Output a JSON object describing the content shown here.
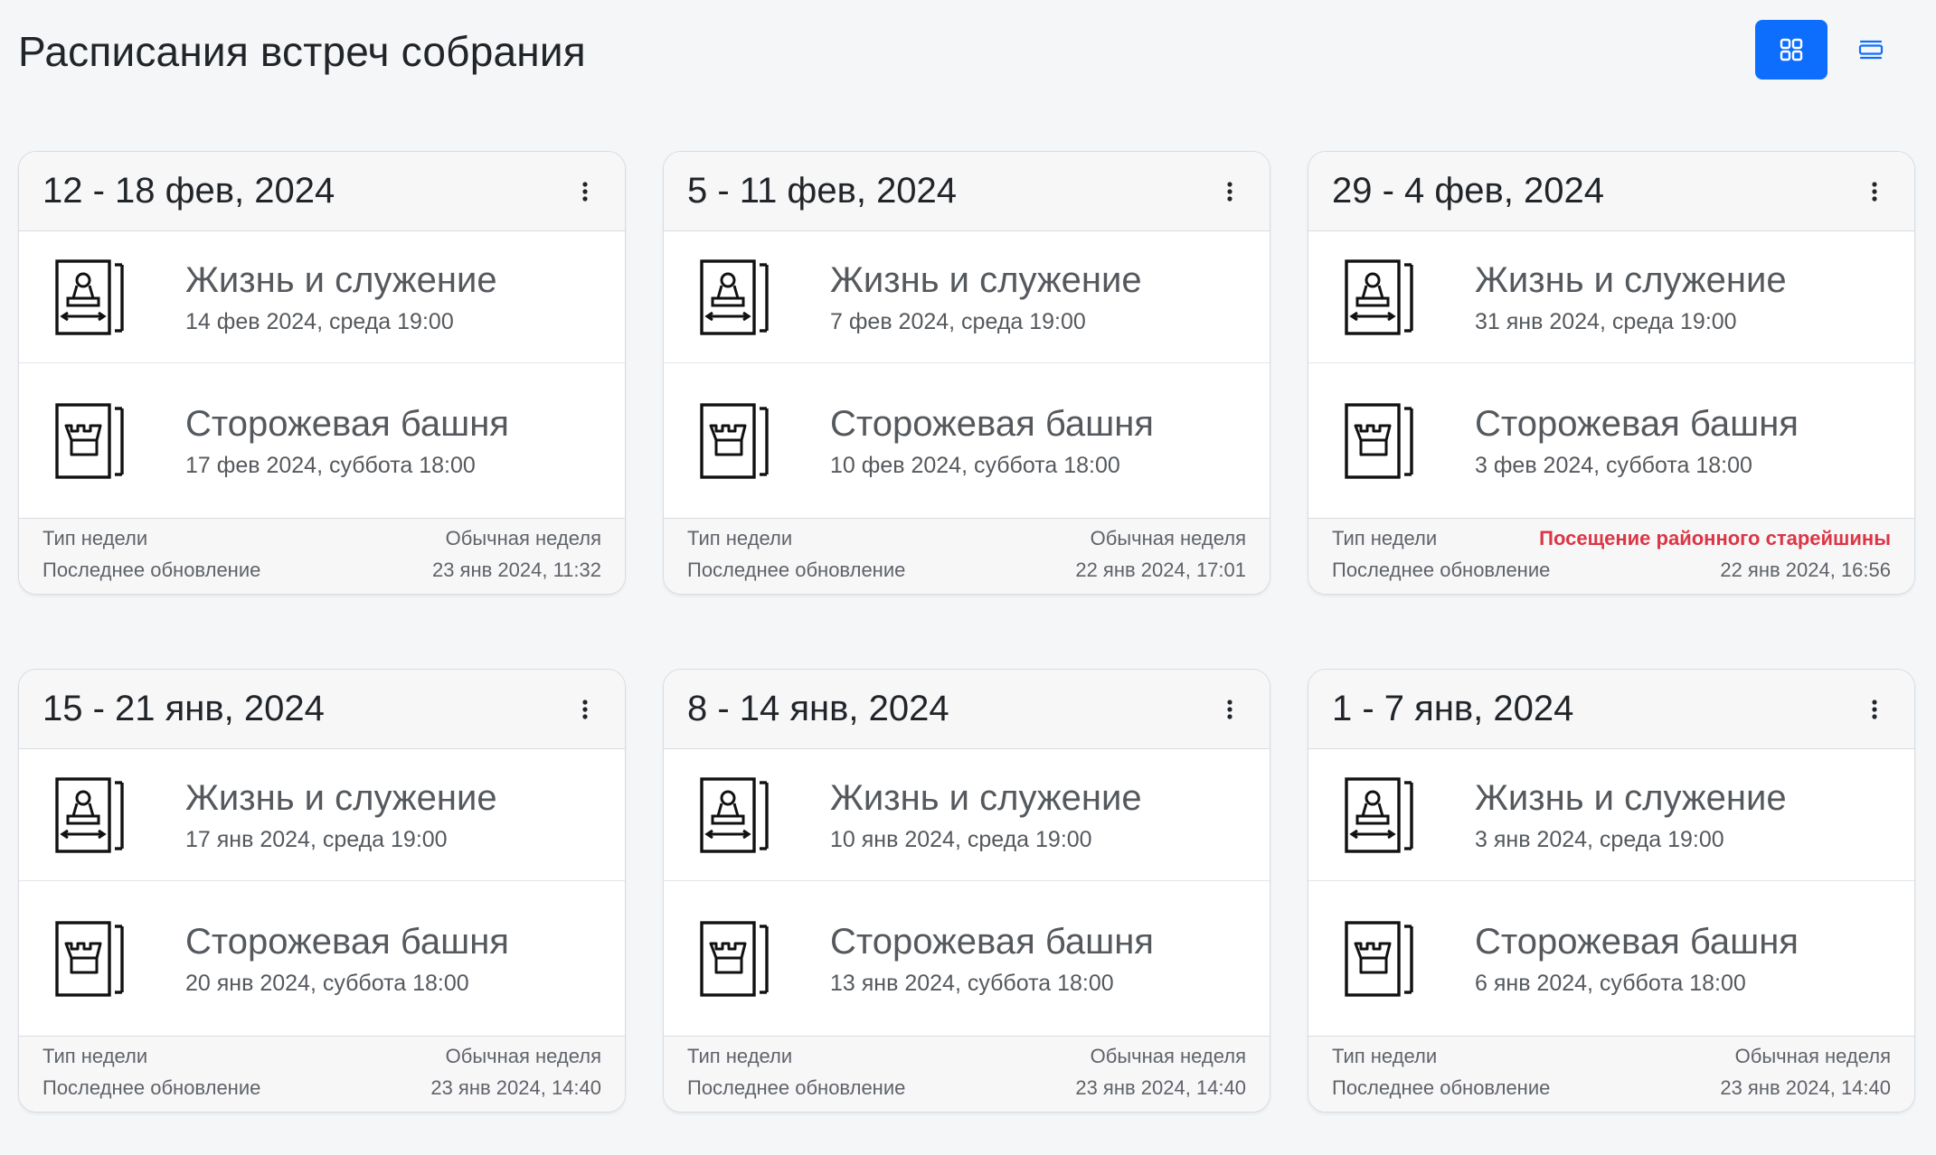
{
  "page": {
    "title": "Расписания встреч собрания"
  },
  "colors": {
    "primary": "#0d6efd",
    "alert": "#dc3545"
  },
  "view_toggle": [
    {
      "name": "grid-view",
      "icon": "grid-icon",
      "active": true
    },
    {
      "name": "list-view",
      "icon": "list-icon",
      "active": false
    }
  ],
  "labels": {
    "week_type": "Тип недели",
    "last_update": "Последнее обновление",
    "midweek": "Жизнь и служение",
    "weekend": "Сторожевая башня"
  },
  "cards": [
    {
      "range": "12 - 18 фев, 2024",
      "midweek_date": "14 фев 2024, среда 19:00",
      "weekend_date": "17 фев 2024, суббота 18:00",
      "week_type": "Обычная неделя",
      "week_type_alert": false,
      "updated": "23 янв 2024, 11:32"
    },
    {
      "range": "5 - 11 фев, 2024",
      "midweek_date": "7 фев 2024, среда 19:00",
      "weekend_date": "10 фев 2024, суббота 18:00",
      "week_type": "Обычная неделя",
      "week_type_alert": false,
      "updated": "22 янв 2024, 17:01"
    },
    {
      "range": "29 - 4 фев, 2024",
      "midweek_date": "31 янв 2024, среда 19:00",
      "weekend_date": "3 фев 2024, суббота 18:00",
      "week_type": "Посещение районного старейшины",
      "week_type_alert": true,
      "updated": "22 янв 2024, 16:56"
    },
    {
      "range": "15 - 21 янв, 2024",
      "midweek_date": "17 янв 2024, среда 19:00",
      "weekend_date": "20 янв 2024, суббота 18:00",
      "week_type": "Обычная неделя",
      "week_type_alert": false,
      "updated": "23 янв 2024, 14:40"
    },
    {
      "range": "8 - 14 янв, 2024",
      "midweek_date": "10 янв 2024, среда 19:00",
      "weekend_date": "13 янв 2024, суббота 18:00",
      "week_type": "Обычная неделя",
      "week_type_alert": false,
      "updated": "23 янв 2024, 14:40"
    },
    {
      "range": "1 - 7 янв, 2024",
      "midweek_date": "3 янв 2024, среда 19:00",
      "weekend_date": "6 янв 2024, суббота 18:00",
      "week_type": "Обычная неделя",
      "week_type_alert": false,
      "updated": "23 янв 2024, 14:40"
    }
  ]
}
